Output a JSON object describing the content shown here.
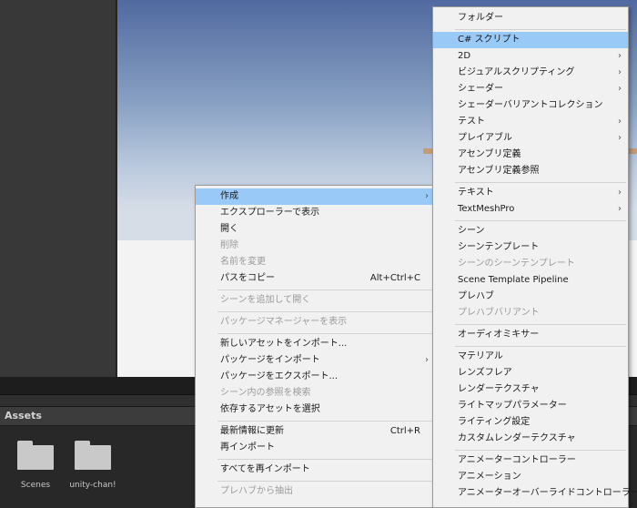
{
  "bottom_panel": {
    "title": "Assets",
    "items": [
      {
        "label": "Scenes",
        "icon": "folder-icon"
      },
      {
        "label": "unity-chan!",
        "icon": "folder-icon"
      }
    ]
  },
  "main_menu": {
    "items": [
      {
        "label": "作成",
        "has_submenu": true,
        "highlighted": true
      },
      {
        "label": "エクスプローラーで表示"
      },
      {
        "label": "開く"
      },
      {
        "label": "削除",
        "disabled": true
      },
      {
        "label": "名前を変更",
        "disabled": true
      },
      {
        "label": "パスをコピー",
        "shortcut": "Alt+Ctrl+C"
      },
      {
        "label": "シーンを追加して開く",
        "disabled": true
      },
      {
        "label": "パッケージマネージャーを表示",
        "disabled": true
      },
      {
        "label": "新しいアセットをインポート..."
      },
      {
        "label": "パッケージをインポート",
        "has_submenu": true
      },
      {
        "label": "パッケージをエクスポート..."
      },
      {
        "label": "シーン内の参照を検索",
        "disabled": true
      },
      {
        "label": "依存するアセットを選択"
      },
      {
        "label": "最新情報に更新",
        "shortcut": "Ctrl+R"
      },
      {
        "label": "再インポート"
      },
      {
        "label": "すべてを再インポート"
      },
      {
        "label": "プレハブから抽出",
        "disabled": true
      }
    ]
  },
  "create_submenu": {
    "items": [
      {
        "label": "フォルダー"
      },
      {
        "label": "C# スクリプト",
        "highlighted": true
      },
      {
        "label": "2D",
        "has_submenu": true
      },
      {
        "label": "ビジュアルスクリプティング",
        "has_submenu": true
      },
      {
        "label": "シェーダー",
        "has_submenu": true
      },
      {
        "label": "シェーダーバリアントコレクション"
      },
      {
        "label": "テスト",
        "has_submenu": true
      },
      {
        "label": "プレイアブル",
        "has_submenu": true
      },
      {
        "label": "アセンブリ定義"
      },
      {
        "label": "アセンブリ定義参照"
      },
      {
        "label": "テキスト",
        "has_submenu": true
      },
      {
        "label": "TextMeshPro",
        "has_submenu": true
      },
      {
        "label": "シーン"
      },
      {
        "label": "シーンテンプレート"
      },
      {
        "label": "シーンのシーンテンプレート",
        "disabled": true
      },
      {
        "label": "Scene Template Pipeline"
      },
      {
        "label": "プレハブ"
      },
      {
        "label": "プレハブバリアント",
        "disabled": true
      },
      {
        "label": "オーディオミキサー"
      },
      {
        "label": "マテリアル"
      },
      {
        "label": "レンズフレア"
      },
      {
        "label": "レンダーテクスチャ"
      },
      {
        "label": "ライトマップパラメーター"
      },
      {
        "label": "ライティング設定"
      },
      {
        "label": "カスタムレンダーテクスチャ"
      },
      {
        "label": "アニメーターコントローラー"
      },
      {
        "label": "アニメーション"
      },
      {
        "label": "アニメーターオーバーライドコントローラー"
      }
    ]
  },
  "colors": {
    "highlight": "#99c9f7",
    "menu_background": "#f1f1f1",
    "disabled_text": "#9a9a9a"
  }
}
